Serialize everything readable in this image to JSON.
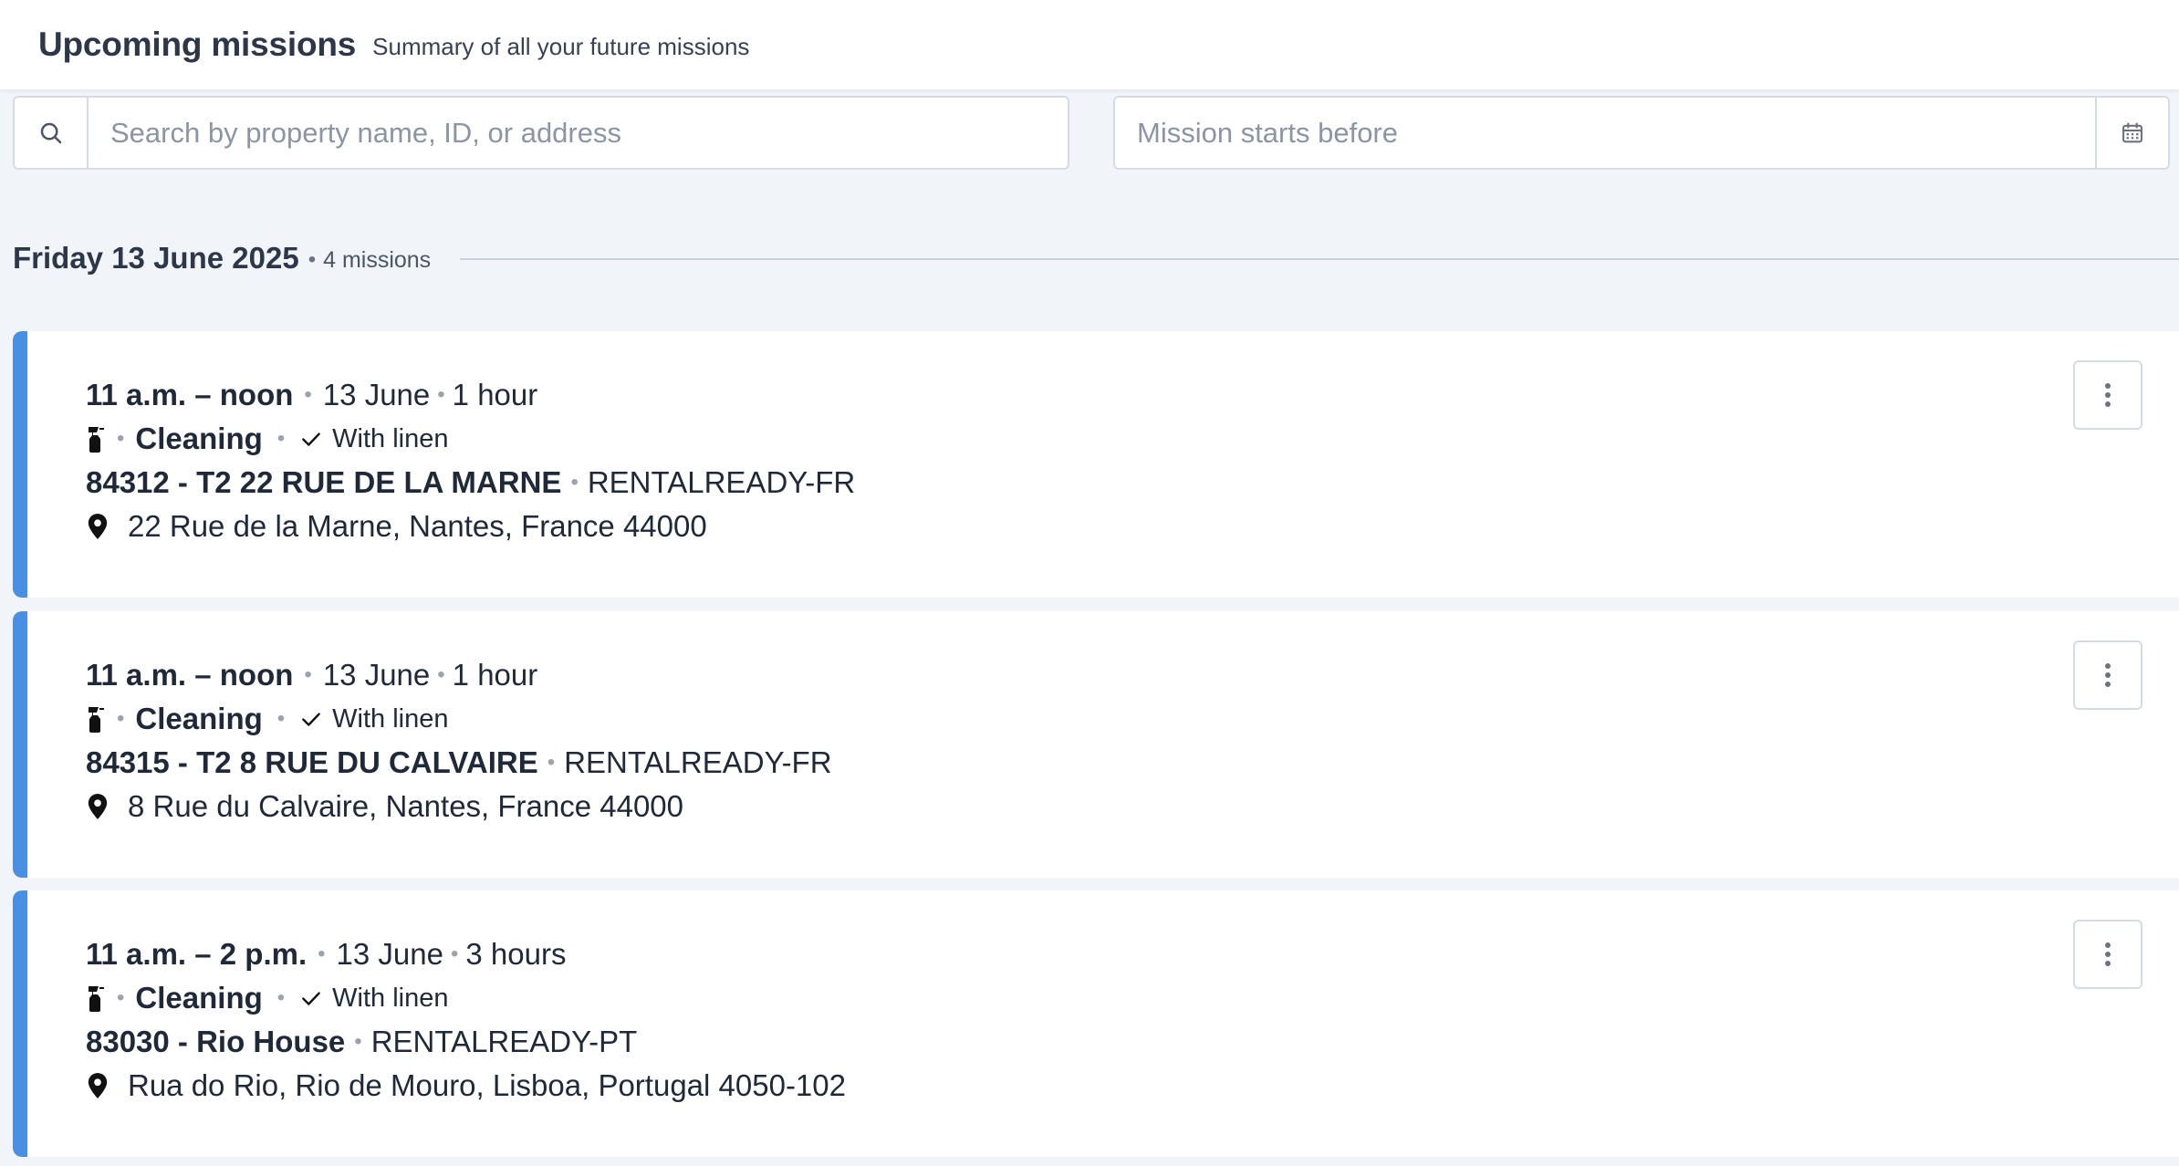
{
  "header": {
    "title": "Upcoming missions",
    "subtitle": "Summary of all your future missions"
  },
  "filters": {
    "search_placeholder": "Search by property name, ID, or address",
    "search_icon": "search-icon",
    "date_placeholder": "Mission starts before",
    "date_icon": "calendar-icon"
  },
  "day_group": {
    "date_label": "Friday 13 June 2025",
    "separator": "•",
    "mission_count": "4 missions"
  },
  "missions": [
    {
      "time": "11 a.m. – noon",
      "date": "13 June",
      "duration": "1 hour",
      "type": "Cleaning",
      "linen": "With linen",
      "property": "84312 - T2 22 RUE DE LA MARNE",
      "account": "RENTALREADY-FR",
      "address": "22 Rue de la Marne, Nantes, France 44000"
    },
    {
      "time": "11 a.m. – noon",
      "date": "13 June",
      "duration": "1 hour",
      "type": "Cleaning",
      "linen": "With linen",
      "property": "84315 - T2 8 RUE DU CALVAIRE",
      "account": "RENTALREADY-FR",
      "address": "8 Rue du Calvaire, Nantes, France 44000"
    },
    {
      "time": "11 a.m. – 2 p.m.",
      "date": "13 June",
      "duration": "3 hours",
      "type": "Cleaning",
      "linen": "With linen",
      "property": "83030 - Rio House",
      "account": "RENTALREADY-PT",
      "address": "Rua do Rio, Rio de Mouro, Lisboa, Portugal 4050-102"
    }
  ],
  "colors": {
    "accent": "#4a90e2",
    "background": "#f1f5fa",
    "border": "#d5dbe3"
  }
}
